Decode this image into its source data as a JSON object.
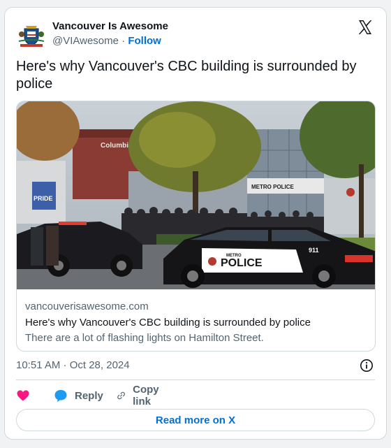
{
  "author": {
    "name": "Vancouver Is Awesome",
    "handle": "@VIAwesome",
    "separator": " · ",
    "follow_label": "Follow"
  },
  "tweet": {
    "text": "Here's why Vancouver's CBC building is surrounded by police"
  },
  "link_card": {
    "domain": "vancouverisawesome.com",
    "title": "Here's why Vancouver's CBC building is surrounded by police",
    "description": "There are a lot of flashing lights on Hamilton Street.",
    "image_text": {
      "building_sign": "Columbie-Br",
      "booth_sign": "METRO POLICE",
      "banner": "PRIDE",
      "car_lettering": "POLICE",
      "car_brand": "METRO",
      "car_number": "911"
    }
  },
  "timestamp": "10:51 AM · Oct 28, 2024",
  "actions": {
    "reply_label": "Reply",
    "copy_label": "Copy link"
  },
  "read_more_label": "Read more on X",
  "colors": {
    "accent": "#006fd6",
    "like": "#f91880",
    "reply": "#1d9bf0",
    "muted": "#536471",
    "border": "#cfd9de"
  },
  "icons": [
    "x-logo-icon",
    "info-icon",
    "heart-icon",
    "reply-bubble-icon",
    "link-icon"
  ]
}
